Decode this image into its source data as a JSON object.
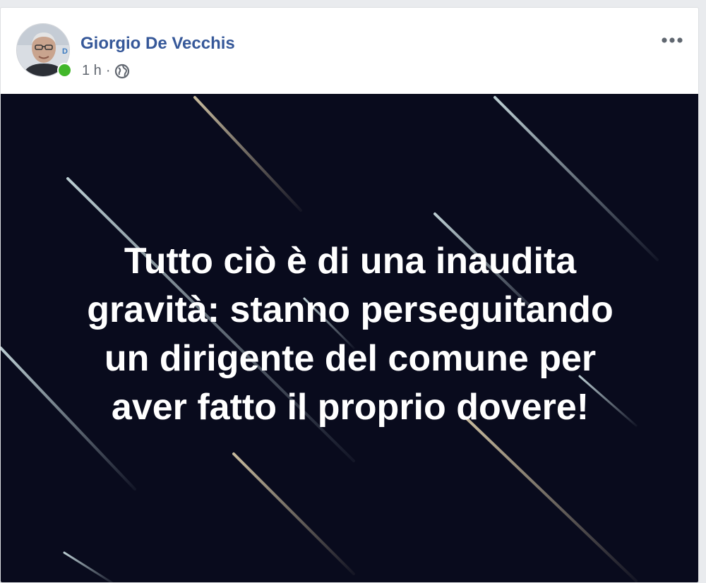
{
  "post": {
    "author": "Giorgio De Vecchis",
    "avatar_icon": "profile-photo",
    "online_status_icon": "online-dot-icon",
    "time": "1 h",
    "separator": "·",
    "privacy_icon": "globe-icon",
    "options_icon": "more-options-icon",
    "image_text_lines": [
      "Tutto ciò è di una inaudita",
      "gravità: stanno perseguitando",
      "un dirigente del comune per",
      "aver fatto il proprio dovere!"
    ]
  },
  "colors": {
    "author_link": "#365899",
    "meta_text": "#616770",
    "online": "#42b72a",
    "image_background": "#090b1d",
    "image_text": "#ffffff"
  }
}
